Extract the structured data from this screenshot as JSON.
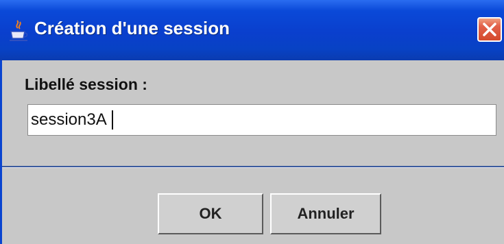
{
  "window": {
    "title": "Création d'une session",
    "icon": "java-cup-icon",
    "close_icon": "close-x-icon"
  },
  "form": {
    "label": "Libellé session :",
    "input_value": "session3A"
  },
  "buttons": {
    "ok_label": "OK",
    "cancel_label": "Annuler"
  },
  "colors": {
    "titlebar": "#0a3fcd",
    "close_button": "#d44a2c",
    "background": "#c8c8c8"
  }
}
